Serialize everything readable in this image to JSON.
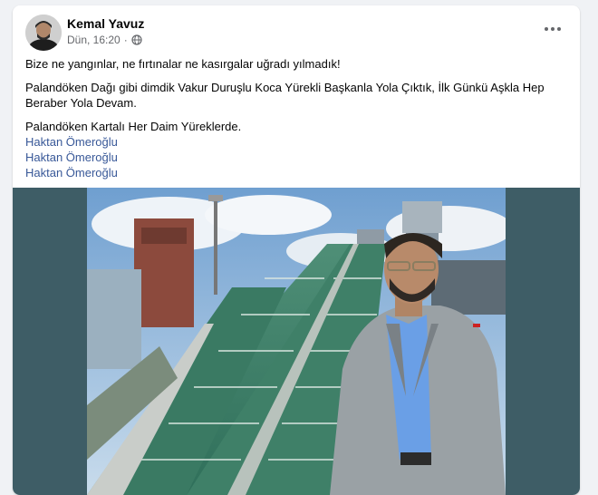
{
  "post": {
    "author": "Kemal Yavuz",
    "time": "Dün, 16:20",
    "privacy_icon": "globe-icon",
    "more_icon": "more-options-icon",
    "paragraphs": [
      "Bize ne yangınlar, ne fırtınalar ne kasırgalar uğradı yılmadık!",
      "Palandöken Dağı gibi dimdik Vakur Duruşlu Koca Yürekli Başkanla Yola Çıktık, İlk Günkü Aşkla Hep Beraber Yola Devam.",
      "Palandöken Kartalı Her Daim Yüreklerde."
    ],
    "mentions": [
      "Haktan Ömeroğlu",
      "Haktan Ömeroğlu",
      "Haktan Ömeroğlu"
    ]
  },
  "colors": {
    "link": "#385898",
    "photo_background": "#3e5d66"
  }
}
